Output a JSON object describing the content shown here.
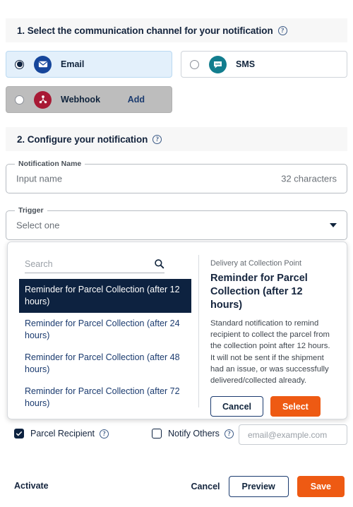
{
  "steps": {
    "step1": {
      "title": "1. Select the communication channel for your notification",
      "help_icon": "help-icon"
    },
    "step2": {
      "title": "2. Configure your notification",
      "help_icon": "help-icon"
    }
  },
  "channels": [
    {
      "id": "email",
      "label": "Email",
      "icon": "envelope-icon",
      "selected": true,
      "icon_color": "#16469b",
      "action": ""
    },
    {
      "id": "sms",
      "label": "SMS",
      "icon": "speech-bubble-sms-icon",
      "selected": false,
      "icon_color": "#127d8e",
      "action": ""
    },
    {
      "id": "webhook",
      "label": "Webhook",
      "icon": "webhook-nodes-icon",
      "selected": false,
      "icon_color": "#a81a35",
      "action": "Add"
    }
  ],
  "form": {
    "name_field": {
      "legend": "Notification Name",
      "placeholder": "Input name",
      "counter": "32 characters"
    },
    "trigger_field": {
      "legend": "Trigger",
      "value": "Select one",
      "caret_icon": "chevron-down-icon"
    }
  },
  "dropdown": {
    "search": {
      "placeholder": "Search",
      "icon": "search-icon"
    },
    "options": [
      {
        "label": "Reminder for Parcel Collection (after 12 hours)",
        "selected": true
      },
      {
        "label": "Reminder for Parcel Collection (after 24 hours)",
        "selected": false
      },
      {
        "label": "Reminder for Parcel Collection (after 48 hours)",
        "selected": false
      },
      {
        "label": "Reminder for Parcel Collection (after 72 hours)",
        "selected": false
      }
    ],
    "detail": {
      "category": "Delivery at Collection Point",
      "title": "Reminder for Parcel Collection (after 12 hours)",
      "description": "Standard notification to remind recipient to collect the parcel from the collection point after 12 hours. It will not be sent if the shipment had an issue, or was successfully delivered/collected already.",
      "cancel_label": "Cancel",
      "select_label": "Select"
    }
  },
  "recipients": {
    "parcel_recipient": {
      "label": "Parcel Recipient",
      "checked": true,
      "help_icon": "help-icon"
    },
    "notify_others": {
      "label": "Notify Others",
      "checked": false,
      "help_icon": "help-icon"
    },
    "email_input": {
      "placeholder": "email@example.com",
      "value": ""
    }
  },
  "footer": {
    "activate_label": "Activate",
    "cancel_label": "Cancel",
    "preview_label": "Preview",
    "save_label": "Save"
  },
  "colors": {
    "accent_orange": "#ee5a13",
    "navy": "#0d2240",
    "link_blue": "#1b3b6f",
    "selected_bg": "#e3f0fb",
    "disabled_bg": "#bdbdbd"
  }
}
